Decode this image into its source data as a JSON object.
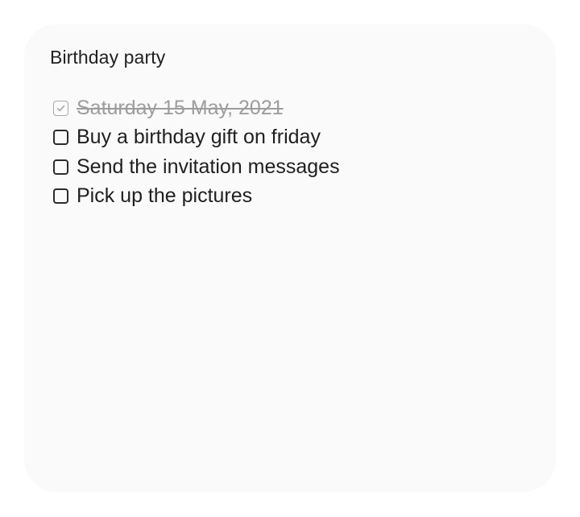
{
  "note": {
    "title": "Birthday party",
    "items": [
      {
        "text": "Saturday 15 May, 2021",
        "checked": true
      },
      {
        "text": "Buy a birthday gift on friday",
        "checked": false
      },
      {
        "text": "Send the invitation messages",
        "checked": false
      },
      {
        "text": "Pick up the pictures",
        "checked": false
      }
    ]
  },
  "colors": {
    "card_background": "#fafafa",
    "text": "#1f1f1f",
    "done_text": "#9d9d9d"
  }
}
